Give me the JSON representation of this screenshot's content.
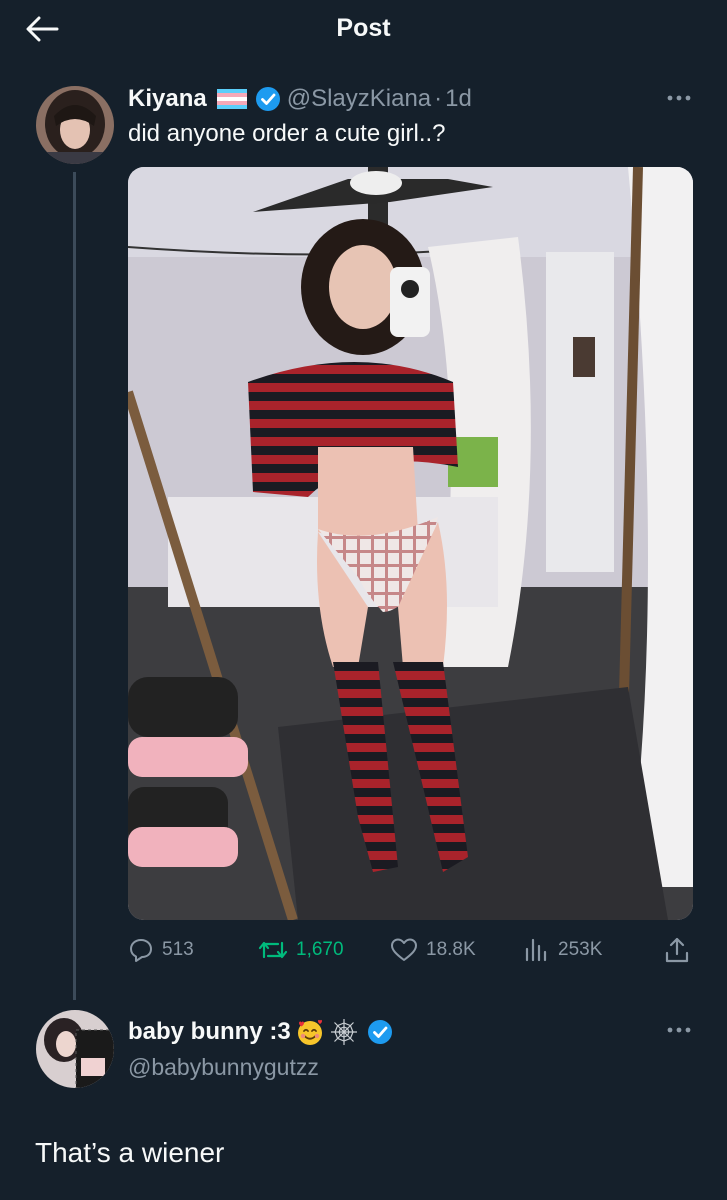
{
  "header": {
    "title": "Post",
    "back_icon": "arrow-left-icon"
  },
  "tweet": {
    "author_name": "Kiyana",
    "author_handle": "@SlayzKiana",
    "separator": "·",
    "time_ago": "1d",
    "text": "did anyone order a cute girl..?",
    "verified": true,
    "stats": {
      "replies": "513",
      "retweets": "1,670",
      "likes": "18.8K",
      "views": "253K"
    }
  },
  "reply": {
    "author_name": "baby bunny :3",
    "author_handle": "@babybunnygutzz",
    "verified": true,
    "text": "That’s a wiener"
  },
  "colors": {
    "background": "#15202b",
    "primary_text": "#f7f9f9",
    "secondary_text": "#8b98a5",
    "retweet_green": "#00ba7c",
    "verified_blue": "#1d9bf0",
    "thread_line": "#3c4b5a"
  }
}
